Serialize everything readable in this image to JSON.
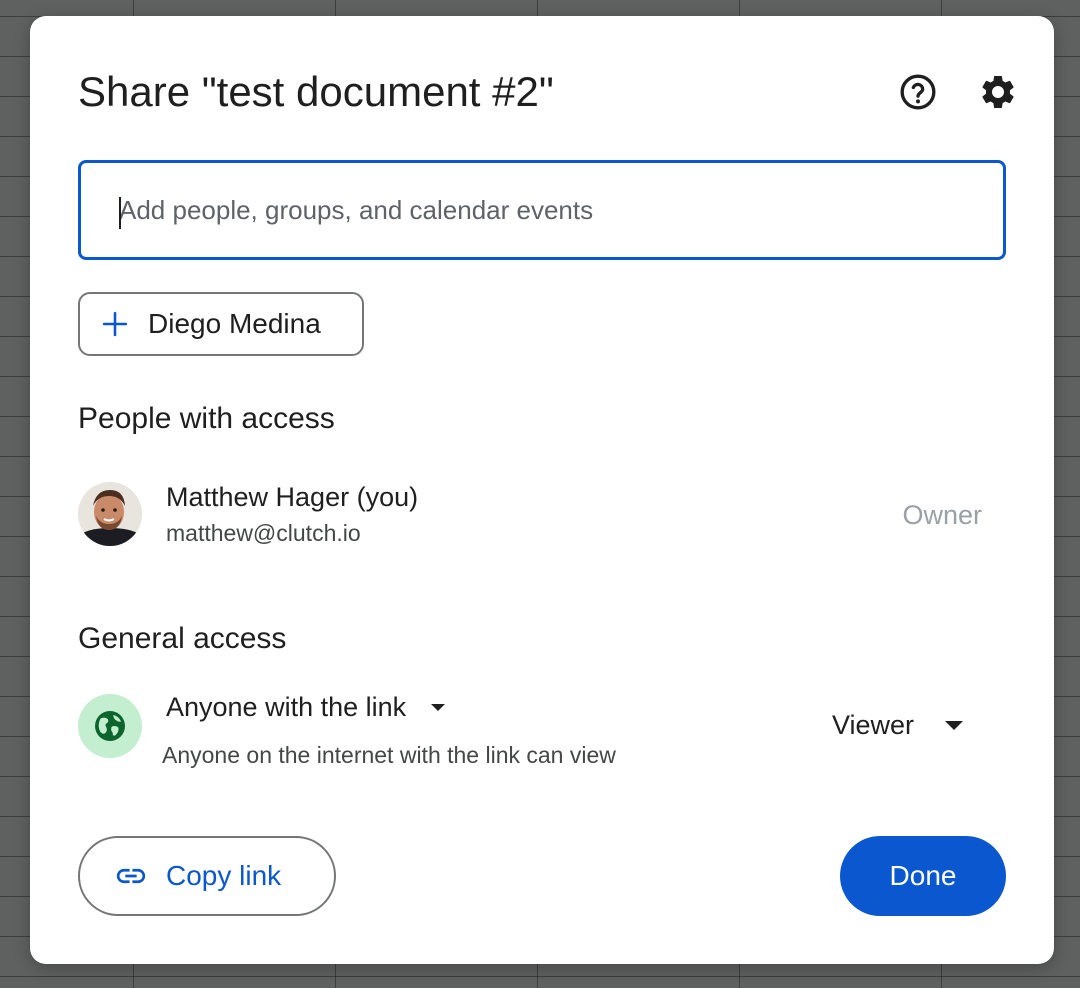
{
  "dialog": {
    "title": "Share \"test document #2\"",
    "help_icon": "help-circle-icon",
    "settings_icon": "gear-icon"
  },
  "share_input": {
    "placeholder": "Add people, groups, and calendar events",
    "value": ""
  },
  "suggestion": {
    "icon": "plus-icon",
    "label": "Diego Medina"
  },
  "people_section": {
    "title": "People with access",
    "people": [
      {
        "name": "Matthew Hager (you)",
        "email": "matthew@clutch.io",
        "role": "Owner"
      }
    ]
  },
  "general_section": {
    "title": "General access",
    "access_level": "Anyone with the link",
    "access_description": "Anyone on the internet with the link can view",
    "role": "Viewer",
    "icon": "globe-icon"
  },
  "footer": {
    "copy_link_label": "Copy link",
    "copy_link_icon": "link-icon",
    "done_label": "Done"
  },
  "colors": {
    "accent": "#0b57d0",
    "globe_bg": "#c4eed0",
    "globe_fg": "#0d652d",
    "owner_text": "#9aa0a6"
  }
}
